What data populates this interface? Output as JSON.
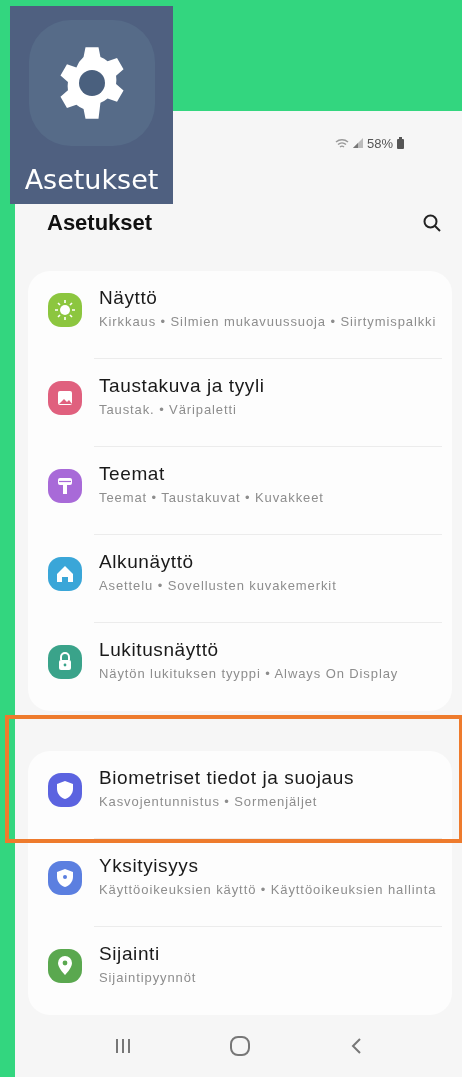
{
  "app_tile": {
    "label": "Asetukset"
  },
  "status_bar": {
    "battery": "58%"
  },
  "header": {
    "title": "Asetukset"
  },
  "groups": [
    {
      "items": [
        {
          "title": "Näyttö",
          "subtitle": "Kirkkaus • Silmien mukavuussuoja • Siirtymispalkki",
          "color": "#8cc63f",
          "highlighted": false
        },
        {
          "title": "Taustakuva ja tyyli",
          "subtitle": "Taustak. • Väripaletti",
          "color": "#e0607e",
          "highlighted": false
        },
        {
          "title": "Teemat",
          "subtitle": "Teemat • Taustakuvat • Kuvakkeet",
          "color": "#a86ad8",
          "highlighted": false
        },
        {
          "title": "Alkunäyttö",
          "subtitle": "Asettelu • Sovellusten kuvakemerkit",
          "color": "#3aa6d8",
          "highlighted": false
        },
        {
          "title": "Lukitusnäyttö",
          "subtitle": "Näytön lukituksen tyyppi • Always On Display",
          "color": "#3aa38a",
          "highlighted": false
        }
      ]
    },
    {
      "items": [
        {
          "title": "Biometriset tiedot ja suojaus",
          "subtitle": "Kasvojentunnistus • Sormenjäljet",
          "color": "#5b63e0",
          "highlighted": true
        },
        {
          "title": "Yksityisyys",
          "subtitle": "Käyttöoikeuksien käyttö • Käyttöoikeuksien hallinta",
          "color": "#5b7fe0",
          "highlighted": false
        },
        {
          "title": "Sijainti",
          "subtitle": "Sijaintipyynnöt",
          "color": "#5aa84f",
          "highlighted": false
        }
      ]
    }
  ]
}
